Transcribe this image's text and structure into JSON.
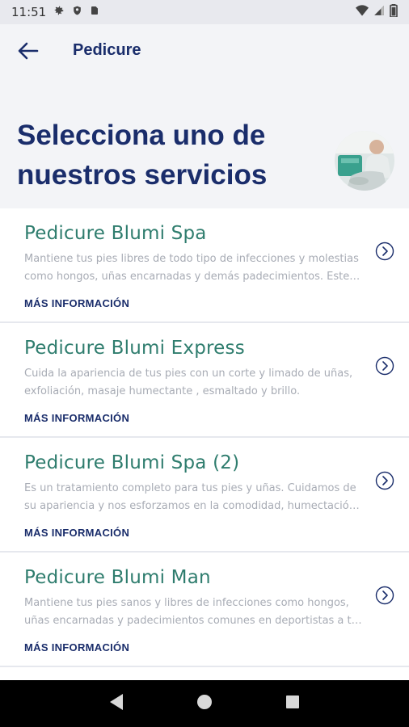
{
  "status_bar": {
    "time": "11:51",
    "left_icons": [
      "settings-icon",
      "shield-icon",
      "sd-card-icon"
    ],
    "right_icons": [
      "wifi-icon",
      "signal-icon",
      "battery-icon"
    ]
  },
  "appbar": {
    "back_icon": "arrow-left-icon",
    "title": "Pedicure"
  },
  "header": {
    "heading": "Selecciona uno de nuestros servicios"
  },
  "colors": {
    "primary": "#1a2d6b",
    "accent": "#2f7d6e",
    "muted": "#a8acb5",
    "header_bg": "#f3f4f7"
  },
  "services": [
    {
      "title": "Pedicure Blumi Spa",
      "desc_line1": "Mantiene tus pies libres de todo tipo de infecciones y molestias",
      "desc_line2": "como  hongos, uñas encarnadas y demás padecimientos. Este tr...",
      "more": "MÁS INFORMACIÓN"
    },
    {
      "title": "Pedicure Blumi Express",
      "desc_line1": "Cuida la apariencia de tus pies con un corte y limado de uñas,",
      "desc_line2": "exfoliación, masaje humectante , esmaltado y brillo.",
      "more": "MÁS INFORMACIÓN"
    },
    {
      "title": "Pedicure Blumi Spa (2)",
      "desc_line1": "Es un tratamiento completo para tus pies y uñas. Cuidamos de",
      "desc_line2": "su apariencia y nos esforzamos en la comodidad, humectación ...",
      "more": "MÁS INFORMACIÓN"
    },
    {
      "title": "Pedicure Blumi Man",
      "desc_line1": "Mantiene tus pies sanos y libres  de infecciones como hongos,",
      "desc_line2": "uñas encarnadas y padecimientos comunes en deportistas a tra...",
      "more": "MÁS INFORMACIÓN"
    }
  ],
  "nav": {
    "icons": [
      "back-triangle-icon",
      "home-circle-icon",
      "recents-square-icon"
    ]
  }
}
